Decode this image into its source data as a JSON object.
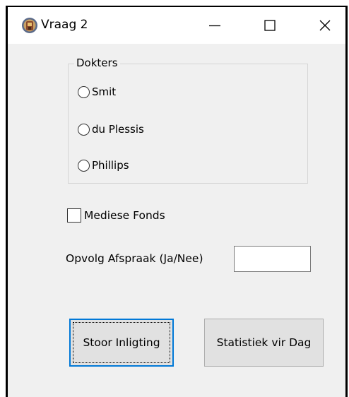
{
  "window": {
    "title": "Vraag 2",
    "controls": {
      "minimize_glyph": "—",
      "maximize_glyph": "☐",
      "close_glyph": "✕"
    }
  },
  "doctors_group": {
    "legend": "Dokters",
    "options": [
      {
        "label": "Smit",
        "selected": false
      },
      {
        "label": "du Plessis",
        "selected": false
      },
      {
        "label": "Phillips",
        "selected": false
      }
    ]
  },
  "medical_aid": {
    "label": "Mediese Fonds",
    "checked": false
  },
  "followup": {
    "label": "Opvolg Afspraak (Ja/Nee)",
    "value": ""
  },
  "buttons": {
    "store_label": "Stoor Inligting",
    "stats_label": "Statistiek vir Dag"
  },
  "icons": {
    "app": "app-icon",
    "minimize": "minimize-icon",
    "maximize": "maximize-icon",
    "close": "close-icon"
  },
  "colors": {
    "window_bg": "#f0f0f0",
    "titlebar_bg": "#ffffff",
    "button_bg": "#e1e1e1",
    "focus_border": "#0078d7"
  }
}
